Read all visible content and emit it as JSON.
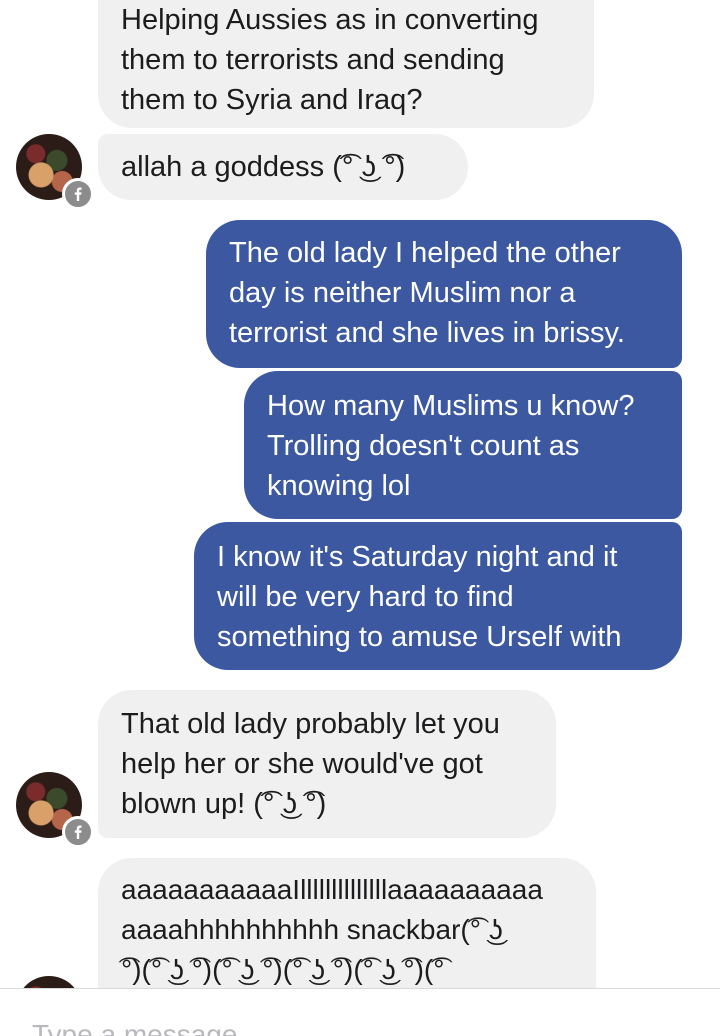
{
  "messages": [
    {
      "direction": "incoming",
      "text": "Helping Aussies as in converting\nthem to terrorists and sending\nthem to Syria and Iraq?"
    },
    {
      "direction": "incoming",
      "text": "allah a goddess (͡° ͜ʖ ͡°)"
    },
    {
      "direction": "outgoing",
      "text": "The old lady I helped the other\nday is neither Muslim nor a\nterrorist and she lives in brissy."
    },
    {
      "direction": "outgoing",
      "text": "How many Muslims u know?\nTrolling doesn't count as\nknowing lol"
    },
    {
      "direction": "outgoing",
      "text": "I know it's Saturday night and it\nwill be very hard to find\nsomething to amuse Urself with"
    },
    {
      "direction": "incoming",
      "text": "That old lady probably let you\nhelp her or she would've got\nblown up! (͡° ͜ʖ ͡°)"
    },
    {
      "direction": "incoming",
      "text": "aaaaaaaaaaaIllllllllllllllaaaaaaaaaa\naaaahhhhhhhhhh snackbar(͡° ͜ʖ\n͡°)(͡° ͜ʖ ͡°)(͡° ͜ʖ ͡°)(͡° ͜ʖ ͡°)(͡° ͜ʖ ͡°)(͡°"
    }
  ],
  "avatar": {
    "icon": "facebook-badge-icon",
    "badge_color": "#8c8c8c"
  },
  "composer": {
    "placeholder": "Type a message..."
  },
  "colors": {
    "outgoing_bubble": "#3b58a0",
    "incoming_bubble": "#f1f0f0",
    "background": "#ffffff"
  }
}
